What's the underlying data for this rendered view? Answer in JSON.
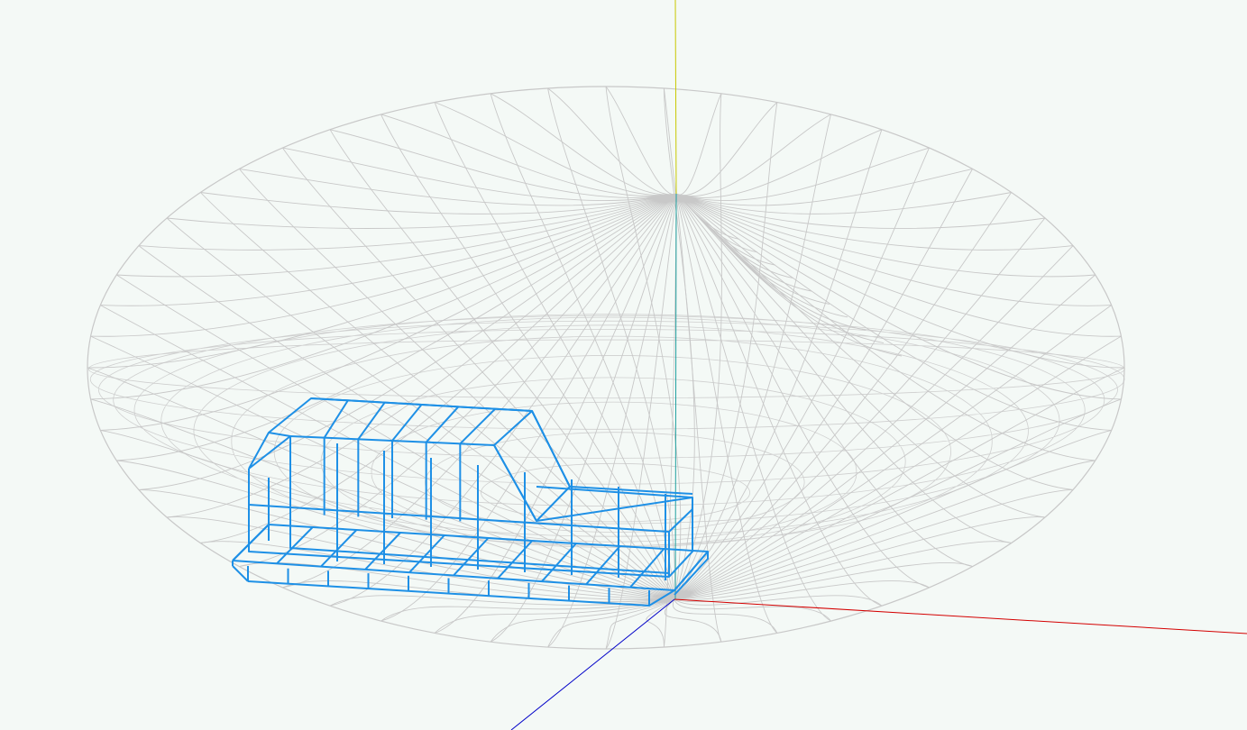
{
  "scene": {
    "background_color": "#f4f9f6",
    "objects": [
      {
        "name": "radiation-pattern-mesh",
        "render": "wireframe",
        "color": "#c8c8c8"
      },
      {
        "name": "vehicle-model",
        "render": "wireframe",
        "color": "#1e90e6"
      }
    ],
    "axes": {
      "x_color": "#d40000",
      "y_color": "#c8c800",
      "y_lower_color": "#20a0a0",
      "z_color": "#0000c8"
    }
  }
}
